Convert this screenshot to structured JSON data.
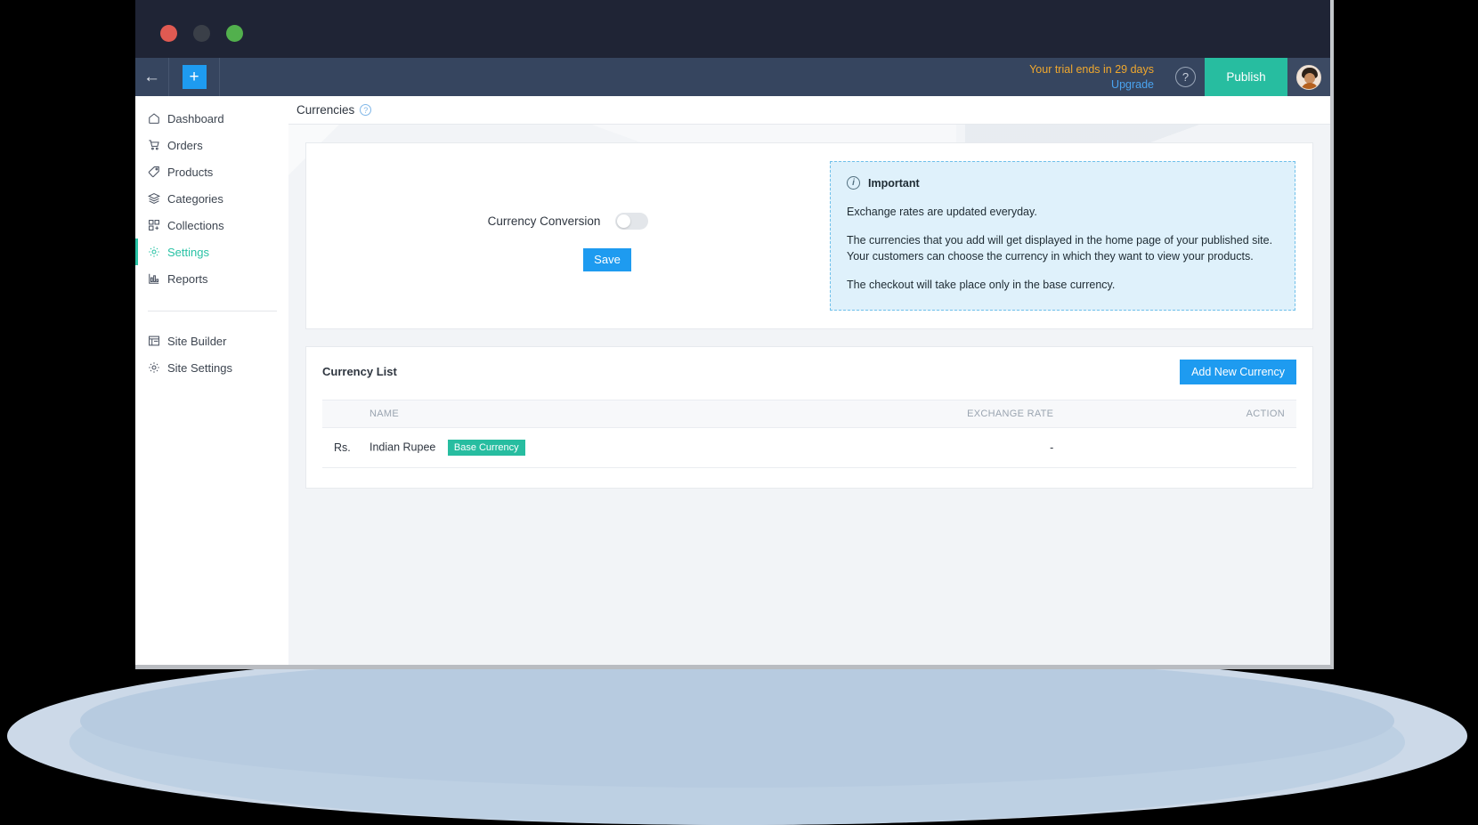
{
  "window": {
    "traffic_lights": [
      "close",
      "minimize",
      "maximize"
    ]
  },
  "appbar": {
    "back_icon": "arrow-left-icon",
    "add_icon": "plus-icon",
    "add_label": "+",
    "back_label": "←",
    "trial_text": "Your trial ends in 29 days",
    "upgrade_label": "Upgrade",
    "help_label": "?",
    "publish_label": "Publish",
    "avatar_alt": "user-avatar",
    "publish_color": "#27bda0",
    "accent_blue": "#1e9bf0",
    "trial_color": "#f0a82e"
  },
  "sidebar": {
    "items": [
      {
        "label": "Dashboard",
        "icon": "home-icon",
        "active": false
      },
      {
        "label": "Orders",
        "icon": "cart-icon",
        "active": false
      },
      {
        "label": "Products",
        "icon": "tag-icon",
        "active": false
      },
      {
        "label": "Categories",
        "icon": "layers-icon",
        "active": false
      },
      {
        "label": "Collections",
        "icon": "grid-icon",
        "active": false
      },
      {
        "label": "Settings",
        "icon": "gear-icon",
        "active": true
      },
      {
        "label": "Reports",
        "icon": "bar-chart-icon",
        "active": false
      }
    ],
    "secondary": [
      {
        "label": "Site Builder",
        "icon": "site-builder-icon"
      },
      {
        "label": "Site Settings",
        "icon": "gear-icon"
      }
    ],
    "active_color": "#29c2a5"
  },
  "page": {
    "title": "Currencies",
    "title_help_label": "?"
  },
  "conversion": {
    "label": "Currency Conversion",
    "toggle_state": "off",
    "save_label": "Save"
  },
  "info": {
    "heading": "Important",
    "icon": "info-icon",
    "paragraphs": [
      "Exchange rates are updated everyday.",
      "The currencies that you add will get displayed in the home page of your published site. Your customers can choose the currency in which they want to view your products.",
      "The checkout will take place only in the base currency."
    ],
    "border_color": "#6fc0ea",
    "bg_color": "#dff1fb"
  },
  "currency_list": {
    "title": "Currency List",
    "add_button_label": "Add New Currency",
    "columns": [
      "",
      "NAME",
      "EXCHANGE RATE",
      "ACTION"
    ],
    "rows": [
      {
        "symbol": "Rs.",
        "name": "Indian Rupee",
        "badge": "Base Currency",
        "exchange_rate": "-",
        "action": ""
      }
    ],
    "badge_color": "#27bda0"
  }
}
